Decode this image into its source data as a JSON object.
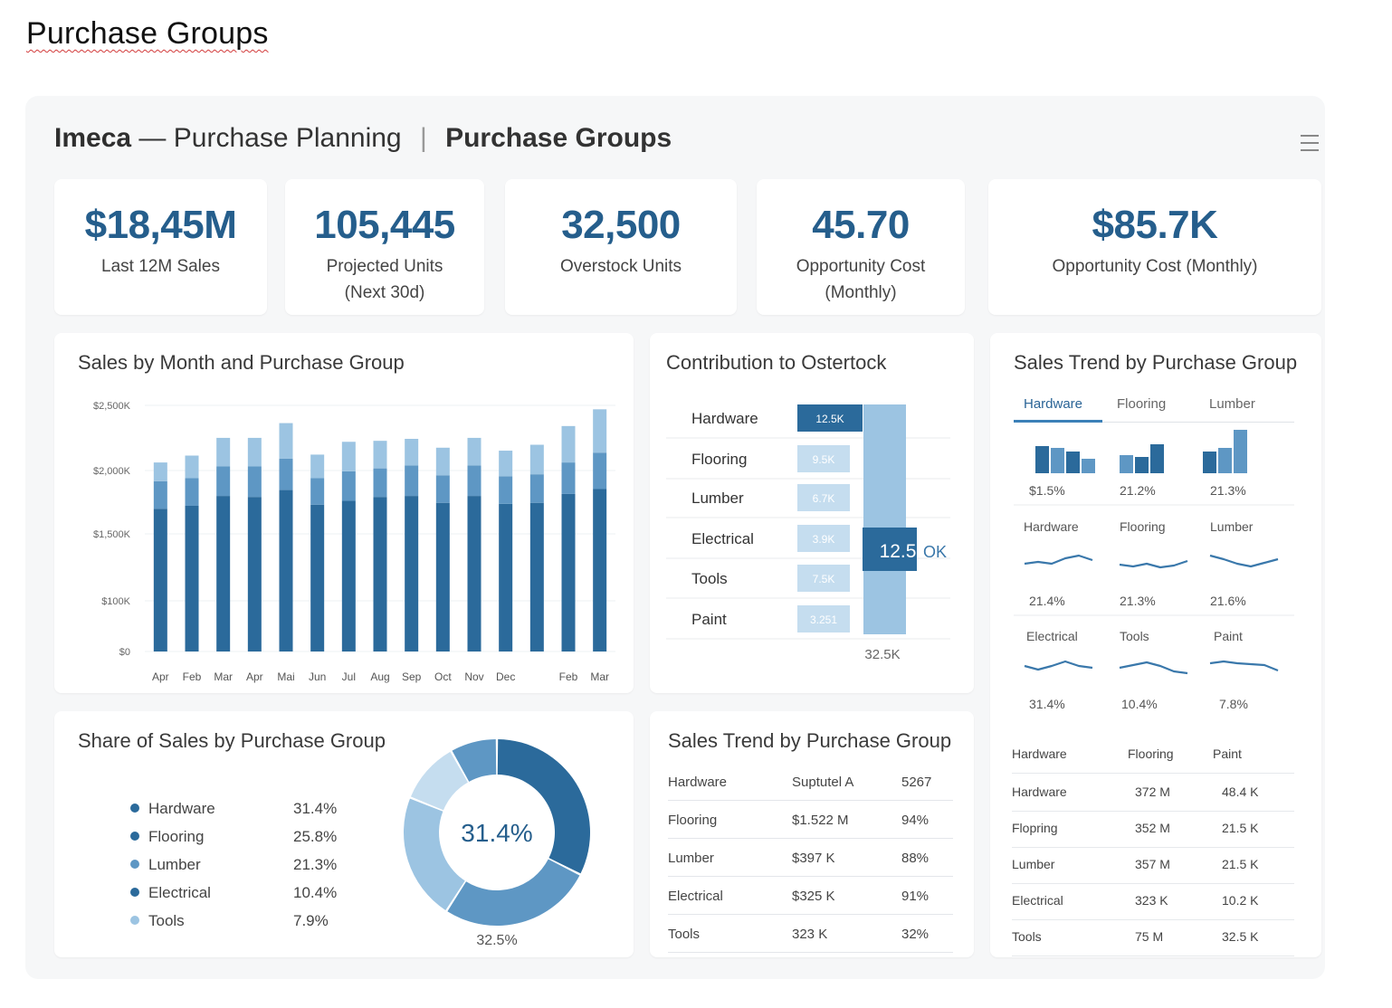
{
  "document_title": "Purchase Groups",
  "header": {
    "brand": "Imeca",
    "dash": "—",
    "subtitle": "Purchase Planning",
    "separator": "|",
    "page": "Purchase Groups"
  },
  "kpis": [
    {
      "value": "$18,45M",
      "label": "Last 12M Sales"
    },
    {
      "value": "105,445",
      "label": "Projected Units (Next 30d)"
    },
    {
      "value": "32,500",
      "label": "Overstock Units"
    },
    {
      "value": "45.70",
      "label": "Opportunity Cost (Monthly)"
    },
    {
      "value": "$85.7K",
      "label": "Opportunity Cost (Monthly)"
    }
  ],
  "panels": {
    "sales_by_month": {
      "title": "Sales by Month and Purchase Group"
    },
    "contribution": {
      "title": "Contribution to Ostertock",
      "rows": [
        {
          "name": "Hardware",
          "value": "12.5K"
        },
        {
          "name": "Flooring",
          "value": "9.5K"
        },
        {
          "name": "Lumber",
          "value": "6.7K"
        },
        {
          "name": "Electrical",
          "value": "3.9K"
        },
        {
          "name": "Tools",
          "value": "7.5K"
        },
        {
          "name": "Paint",
          "value": "3.251"
        }
      ],
      "total_label": "12.5",
      "total_suffix": "OK",
      "footer": "32.5K"
    },
    "trend_right": {
      "title": "Sales Trend by Purchase Group",
      "tabs": [
        "Hardware",
        "Flooring",
        "Lumber"
      ],
      "bar_pcts": [
        "$1.5%",
        "21.2%",
        "21.3%"
      ],
      "spark_row1": {
        "labels": [
          "Hardware",
          "Flooring",
          "Lumber"
        ],
        "pcts": [
          "21.4%",
          "21.3%",
          "21.6%"
        ]
      },
      "spark_row2": {
        "labels": [
          "Electrical",
          "Tools",
          "Paint"
        ],
        "pcts": [
          "31.4%",
          "10.4%",
          "7.8%"
        ]
      },
      "table": {
        "headers": [
          "Hardware",
          "Flooring",
          "Paint"
        ],
        "rows": [
          [
            "Hardware",
            "372 M",
            "48.4 K"
          ],
          [
            "Flopring",
            "352 M",
            "21.5 K"
          ],
          [
            "Lumber",
            "357 M",
            "21.5 K"
          ],
          [
            "Electrical",
            "323 K",
            "10.2 K"
          ],
          [
            "Tools",
            "75 M",
            "32.5 K"
          ]
        ]
      }
    },
    "share": {
      "title": "Share of Sales by Purchase Group",
      "center_label": "31.4%",
      "footer_label": "32.5%"
    },
    "trend_table": {
      "title": "Sales Trend by Purchase Group",
      "header": [
        "Hardware",
        "Suptutel A",
        "5267"
      ],
      "rows": [
        [
          "Flooring",
          "$1.522 M",
          "94%"
        ],
        [
          "Lumber",
          "$397 K",
          "88%"
        ],
        [
          "Electrical",
          "$325 K",
          "91%"
        ],
        [
          "Tools",
          "323 K",
          "32%"
        ]
      ]
    }
  },
  "colors": {
    "dark": "#2b6a9b",
    "mid": "#5e97c4",
    "light": "#9cc4e2",
    "pale": "#c5ddef",
    "accent_text": "#255e8c"
  },
  "chart_data": [
    {
      "type": "bar",
      "title": "Sales by Month and Purchase Group",
      "categories": [
        "Apr",
        "Feb",
        "Mar",
        "Apr",
        "Mai",
        "Jun",
        "Jul",
        "Aug",
        "Sep",
        "Oct",
        "Nov",
        "Dec",
        "",
        "Feb",
        "Mar"
      ],
      "y_ticks": [
        "$2,500K",
        "$2,000K",
        "$1,500K",
        "$100K",
        "$0"
      ],
      "ylim": [
        0,
        2500
      ],
      "stacked": true,
      "series": [
        {
          "values": [
            1450,
            1480,
            1580,
            1570,
            1640,
            1490,
            1530,
            1570,
            1580,
            1510,
            1580,
            1500,
            1510,
            1600,
            1650
          ]
        },
        {
          "values": [
            280,
            280,
            300,
            310,
            320,
            270,
            300,
            290,
            310,
            280,
            310,
            280,
            290,
            320,
            370
          ]
        },
        {
          "values": [
            190,
            230,
            290,
            290,
            360,
            240,
            300,
            280,
            270,
            280,
            280,
            260,
            300,
            370,
            440
          ]
        }
      ]
    },
    {
      "type": "bar",
      "title": "Contribution to Ostertock",
      "categories": [
        "Hardware",
        "Flooring",
        "Lumber",
        "Electrical",
        "Tools",
        "Paint"
      ],
      "values": [
        12.5,
        9.5,
        6.7,
        3.9,
        7.5,
        3.251
      ]
    },
    {
      "type": "pie",
      "title": "Share of Sales by Purchase Group",
      "legend": [
        {
          "name": "Hardware",
          "pct": "31.4%",
          "value": 31.4
        },
        {
          "name": "Flooring",
          "pct": "25.8%",
          "value": 25.8
        },
        {
          "name": "Lumber",
          "pct": "21.3%",
          "value": 21.3
        },
        {
          "name": "Electrical",
          "pct": "10.4%",
          "value": 10.4
        },
        {
          "name": "Tools",
          "pct": "7.9%",
          "value": 7.9
        }
      ]
    }
  ]
}
